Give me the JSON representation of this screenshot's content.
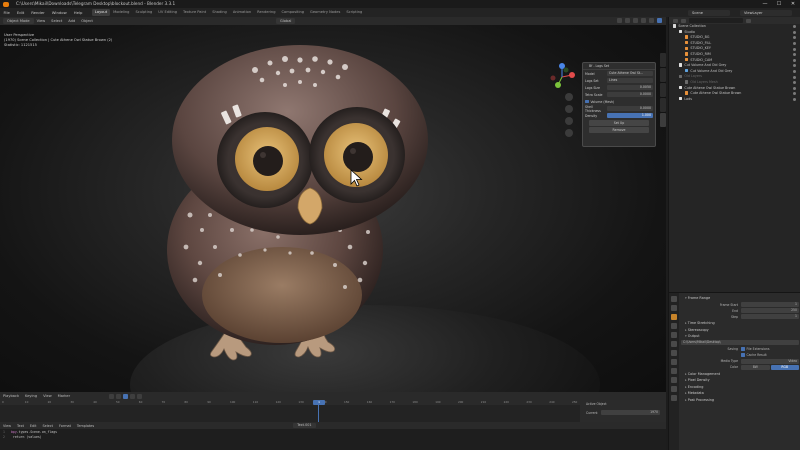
{
  "window": {
    "title": "C:\\Users\\Mikail\\Downloads\\Telegram Desktop\\blockout.blend - Blender 3.3.1",
    "controls": [
      "—",
      "☐",
      "✕"
    ]
  },
  "menu": {
    "items": [
      "File",
      "Edit",
      "Render",
      "Window",
      "Help"
    ],
    "workspaces": [
      "Layout",
      "Modeling",
      "Sculpting",
      "UV Editing",
      "Texture Paint",
      "Shading",
      "Animation",
      "Rendering",
      "Compositing",
      "Geometry Nodes",
      "Scripting"
    ],
    "active_workspace": "Layout",
    "scene": "Scene",
    "view_layer": "ViewLayer"
  },
  "viewport_header": {
    "mode": "Object Mode",
    "items": [
      "View",
      "Select",
      "Add",
      "Object"
    ],
    "orientation": "Global"
  },
  "viewport_info": [
    "User Perspective",
    "(1970) Scene Collection | Cute Athene Owl Statue Brown (2)",
    "Statistic: 1121515"
  ],
  "popover": {
    "title": "Bf - Logs Set",
    "rows": [
      {
        "label": "Model",
        "value": "Cute Athene Owl St...",
        "kind": "field"
      },
      {
        "label": "Logs Set",
        "value": "Lines",
        "kind": "field"
      },
      {
        "label": "Logs Size",
        "value": "0.0050",
        "kind": "num"
      },
      {
        "label": "Tetra Scale",
        "value": "0.0000",
        "kind": "num"
      },
      {
        "label": "Volume (Mesh)",
        "value": "",
        "kind": "check"
      },
      {
        "label": "Shell Thickness",
        "value": "0.0000",
        "kind": "num"
      },
      {
        "label": "Density",
        "value": "1.000",
        "kind": "sel"
      }
    ],
    "buttons": [
      "Set Up",
      "Remove"
    ]
  },
  "viewport_tabs": [
    "Item",
    "Tool",
    "View",
    "Edit",
    "Bf-Logs"
  ],
  "outliner": {
    "rows": [
      {
        "indent": 0,
        "label": "Scene Collection",
        "color": "#d9d9d9",
        "dim": false
      },
      {
        "indent": 1,
        "label": "Studio",
        "color": "#e0e0e0",
        "dim": false
      },
      {
        "indent": 2,
        "label": "STUDIO_BG",
        "color": "#e8913a",
        "dim": false
      },
      {
        "indent": 2,
        "label": "STUDIO_FILL",
        "color": "#e8913a",
        "dim": false
      },
      {
        "indent": 2,
        "label": "STUDIO_KEY",
        "color": "#e8913a",
        "dim": false
      },
      {
        "indent": 2,
        "label": "STUDIO_RIM",
        "color": "#e8913a",
        "dim": false
      },
      {
        "indent": 2,
        "label": "STUDIO_CAM",
        "color": "#e8913a",
        "dim": false
      },
      {
        "indent": 1,
        "label": "Cut Volume And Old Grey",
        "color": "#e0e0e0",
        "dim": false
      },
      {
        "indent": 2,
        "label": "Cut Volume And Old Grey",
        "color": "#5fa2dd",
        "dim": false
      },
      {
        "indent": 1,
        "label": "Old Layers",
        "color": "#6a6a6a",
        "dim": true
      },
      {
        "indent": 2,
        "label": "Old Layers Mesh",
        "color": "#6a6a6a",
        "dim": true
      },
      {
        "indent": 1,
        "label": "Cute Athene Owl Statue Brown",
        "color": "#e0e0e0",
        "dim": false
      },
      {
        "indent": 2,
        "label": "Cute Athene Owl Statue Brown",
        "color": "#e8913a",
        "dim": false
      },
      {
        "indent": 1,
        "label": "Lods",
        "color": "#e0e0e0",
        "dim": false
      }
    ]
  },
  "properties": {
    "sections": [
      {
        "title": "Frame Range",
        "open": true
      },
      {
        "row": "Frame Start",
        "value": "1"
      },
      {
        "row": "End",
        "value": "250"
      },
      {
        "row": "Step",
        "value": "1"
      },
      {
        "title": "Time Stretching",
        "open": false
      },
      {
        "title": "Stereoscopy",
        "open": false
      },
      {
        "title": "Output",
        "open": true
      },
      {
        "path": "C:\\Users\\Mikail\\Desktop\\"
      },
      {
        "row": "Saving",
        "check": "File Extensions"
      },
      {
        "row": "",
        "check": "Cache Result"
      },
      {
        "row": "Media Type",
        "value": "Video"
      },
      {
        "row": "Color",
        "seg": [
          "BW",
          "RGB"
        ],
        "seg_on": 1
      },
      {
        "title": "Color Management",
        "open": false
      },
      {
        "title": "Pixel Density",
        "open": false
      },
      {
        "title": "Encoding",
        "open": false
      },
      {
        "title": "Metadata",
        "open": false
      },
      {
        "title": "Post Processing",
        "open": false
      }
    ]
  },
  "timeline": {
    "header": [
      "Playback",
      "Keying",
      "View",
      "Marker"
    ],
    "ticks": [
      "0",
      "10",
      "20",
      "30",
      "40",
      "50",
      "60",
      "70",
      "80",
      "90",
      "100",
      "110",
      "120",
      "130",
      "140",
      "150",
      "160",
      "170",
      "180",
      "190",
      "200",
      "210",
      "220",
      "230",
      "240",
      "250"
    ],
    "current_frame": "1",
    "side": {
      "label1": "Active Object",
      "label2": "Current",
      "value2": "1970"
    }
  },
  "text_editor": {
    "header": [
      "View",
      "Text",
      "Edit",
      "Select",
      "Format",
      "Templates"
    ],
    "filename": "Text.001",
    "lines": [
      {
        "num": "1",
        "kw": "bpy",
        "rest": ".types.Scene.cm_flags"
      },
      {
        "num": "2",
        "kw": "",
        "rest": "    return (values)"
      }
    ]
  }
}
